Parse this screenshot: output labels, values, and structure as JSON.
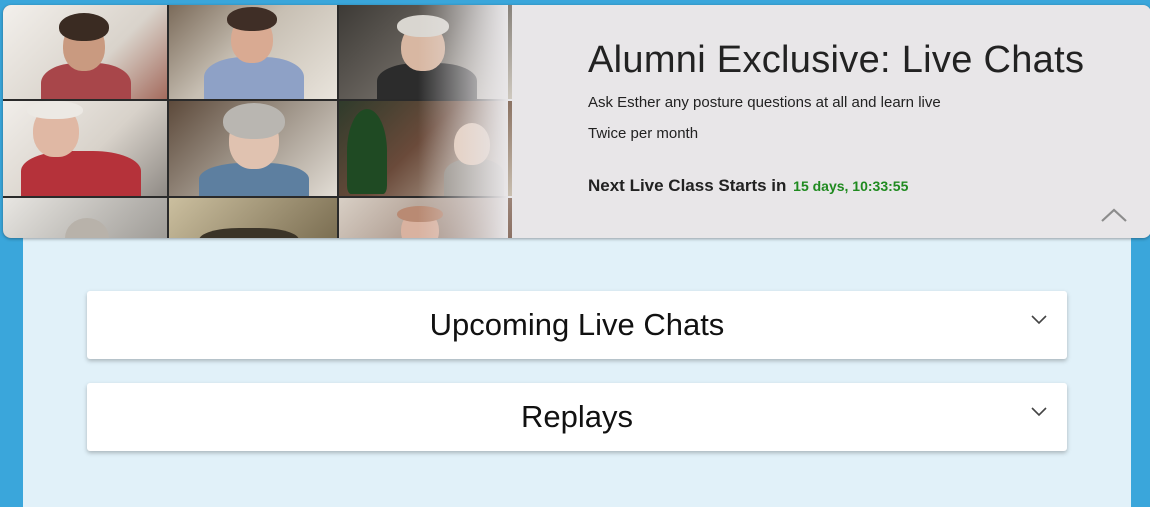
{
  "header": {
    "title": "Alumni Exclusive: Live Chats",
    "subtitle": "Ask Esther any posture questions at all and learn live",
    "frequency": "Twice per month",
    "next_class_label": "Next Live Class Starts in",
    "countdown": "15 days, 10:33:55"
  },
  "sections": [
    {
      "label": "Upcoming Live Chats",
      "icon": "chevron-down-icon"
    },
    {
      "label": "Replays",
      "icon": "chevron-down-icon"
    }
  ],
  "colors": {
    "page_background": "#3aa6db",
    "panel_background": "#e1f1f9",
    "header_background": "#e8e6e8",
    "countdown": "#1f8a1f"
  }
}
